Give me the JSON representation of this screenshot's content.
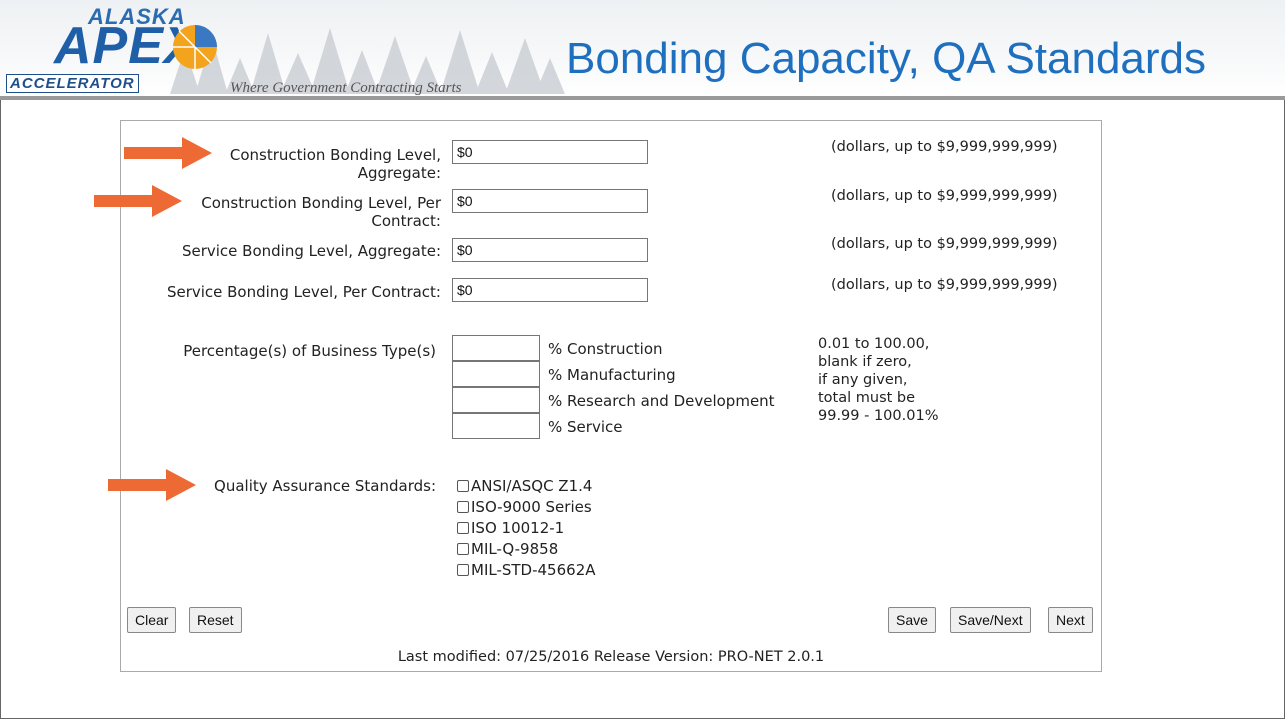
{
  "header": {
    "logo_top": "ALASKA",
    "logo_main": "APEX",
    "logo_sub": "ACCELERATOR",
    "tagline": "Where Government Contracting Starts",
    "title": "Bonding Capacity, QA Standards"
  },
  "bonding": [
    {
      "label_line1": "Construction Bonding Level,",
      "label_line2": "Aggregate:",
      "value": "$0",
      "hint": "(dollars, up to $9,999,999,999)"
    },
    {
      "label_line1": "Construction Bonding Level, Per",
      "label_line2": "Contract:",
      "value": "$0",
      "hint": "(dollars, up to $9,999,999,999)"
    },
    {
      "label_line1": "Service Bonding Level, Aggregate:",
      "value": "$0",
      "hint": "(dollars, up to $9,999,999,999)"
    },
    {
      "label_line1": "Service Bonding Level, Per Contract:",
      "value": "$0",
      "hint": "(dollars, up to $9,999,999,999)"
    }
  ],
  "business_types": {
    "label": "Percentage(s) of Business Type(s)",
    "items": [
      "% Construction",
      "% Manufacturing",
      "% Research and Development",
      "% Service"
    ],
    "hint_lines": [
      "0.01 to 100.00,",
      "blank if zero,",
      "if any given,",
      "total must be",
      "99.99 - 100.01%"
    ]
  },
  "qa": {
    "label": "Quality Assurance Standards:",
    "options": [
      "ANSI/ASQC Z1.4",
      "ISO-9000 Series",
      "ISO 10012-1",
      "MIL-Q-9858",
      "MIL-STD-45662A"
    ]
  },
  "buttons": {
    "clear": "Clear",
    "reset": "Reset",
    "save": "Save",
    "save_next": "Save/Next",
    "next": "Next"
  },
  "footer": "Last modified: 07/25/2016 Release Version: PRO-NET 2.0.1",
  "colors": {
    "title": "#1f6fbf",
    "arrow": "#ee6a35",
    "logo": "#1f5fa8"
  }
}
